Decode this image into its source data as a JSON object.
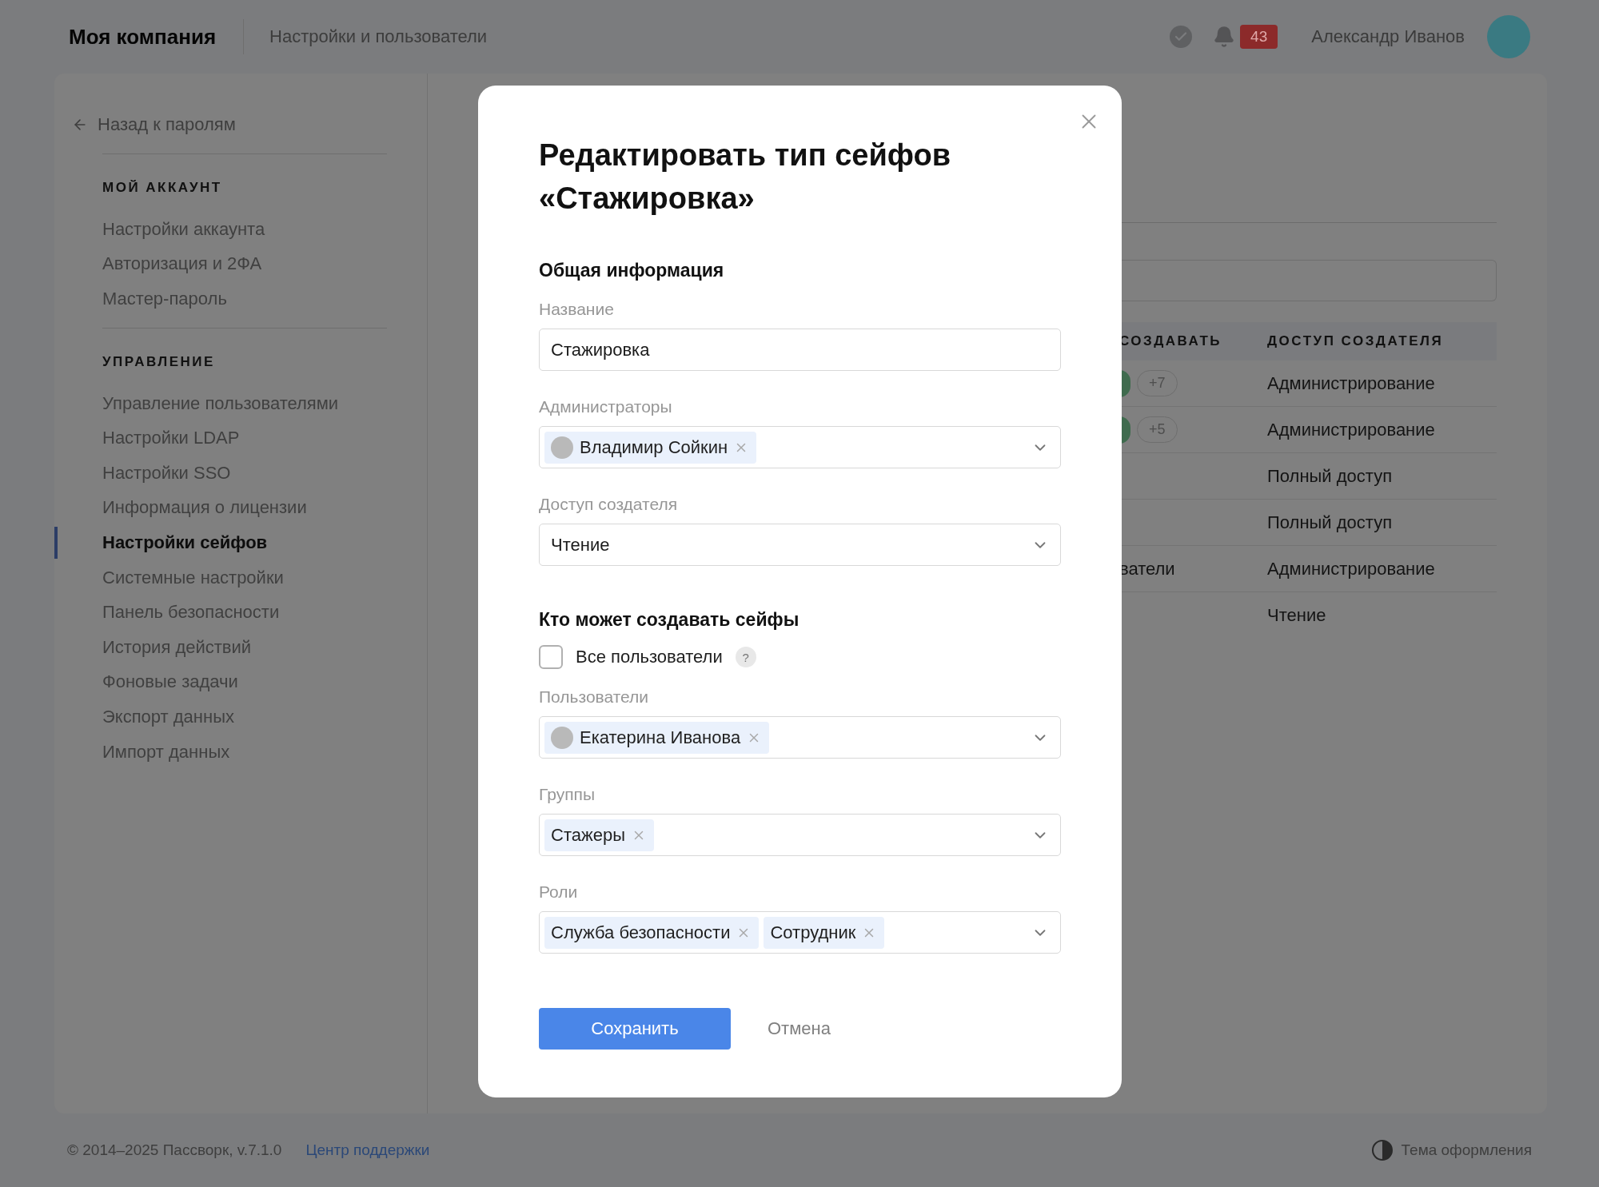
{
  "header": {
    "company": "Моя компания",
    "section": "Настройки и пользователи",
    "notifications": "43",
    "user": "Александр Иванов"
  },
  "sidebar": {
    "back": "Назад к паролям",
    "groups": [
      {
        "title": "МОЙ АККАУНТ",
        "items": [
          {
            "label": "Настройки аккаунта",
            "selected": false
          },
          {
            "label": "Авторизация и 2ФА",
            "selected": false
          },
          {
            "label": "Мастер-пароль",
            "selected": false
          }
        ]
      },
      {
        "title": "УПРАВЛЕНИЕ",
        "items": [
          {
            "label": "Управление пользователями",
            "selected": false
          },
          {
            "label": "Настройки LDAP",
            "selected": false
          },
          {
            "label": "Настройки SSO",
            "selected": false
          },
          {
            "label": "Информация о лицензии",
            "selected": false
          },
          {
            "label": "Настройки сейфов",
            "selected": true
          },
          {
            "label": "Системные настройки",
            "selected": false
          },
          {
            "label": "Панель безопасности",
            "selected": false
          },
          {
            "label": "История действий",
            "selected": false
          },
          {
            "label": "Фоновые задачи",
            "selected": false
          },
          {
            "label": "Экспорт данных",
            "selected": false
          },
          {
            "label": "Импорт данных",
            "selected": false
          }
        ]
      }
    ]
  },
  "table": {
    "columns": [
      "СОЗДАВАТЬ",
      "ДОСТУП СОЗДАТЕЛЯ"
    ],
    "rows": [
      {
        "more": "+7",
        "access": "Администрирование"
      },
      {
        "more": "+5",
        "access": "Администрирование"
      },
      {
        "access": "Полный доступ"
      },
      {
        "access": "Полный доступ"
      },
      {
        "column_1": "ватели",
        "access": "Администрирование"
      },
      {
        "access": "Чтение"
      }
    ]
  },
  "modal": {
    "title": "Редактировать тип сейфов «Стажировка»",
    "sections": [
      {
        "title": "Общая информация",
        "fields": [
          {
            "kind": "text",
            "label": "Название",
            "value": "Стажировка"
          },
          {
            "kind": "tags",
            "label": "Администраторы",
            "tags": [
              {
                "label": "Владимир Сойкин",
                "avatar": true
              }
            ]
          },
          {
            "kind": "select",
            "label": "Доступ создателя",
            "value": "Чтение"
          }
        ]
      },
      {
        "title": "Кто может создавать сейфы",
        "fields": [
          {
            "kind": "checkbox",
            "label": "Все пользователи",
            "checked": false,
            "help": "?"
          },
          {
            "kind": "tags",
            "label": "Пользователи",
            "tags": [
              {
                "label": "Екатерина Иванова",
                "avatar": true
              }
            ]
          },
          {
            "kind": "tags",
            "label": "Группы",
            "tags": [
              {
                "label": "Стажеры",
                "avatar": false
              }
            ]
          },
          {
            "kind": "tags",
            "label": "Роли",
            "tags": [
              {
                "label": "Служба безопасности",
                "avatar": false
              },
              {
                "label": "Сотрудник",
                "avatar": false
              }
            ]
          }
        ]
      }
    ],
    "save": "Сохранить",
    "cancel": "Отмена"
  },
  "footer": {
    "copyright": "© 2014–2025 Пассворк, v.7.1.0",
    "support": "Центр поддержки",
    "theme": "Тема оформления"
  }
}
